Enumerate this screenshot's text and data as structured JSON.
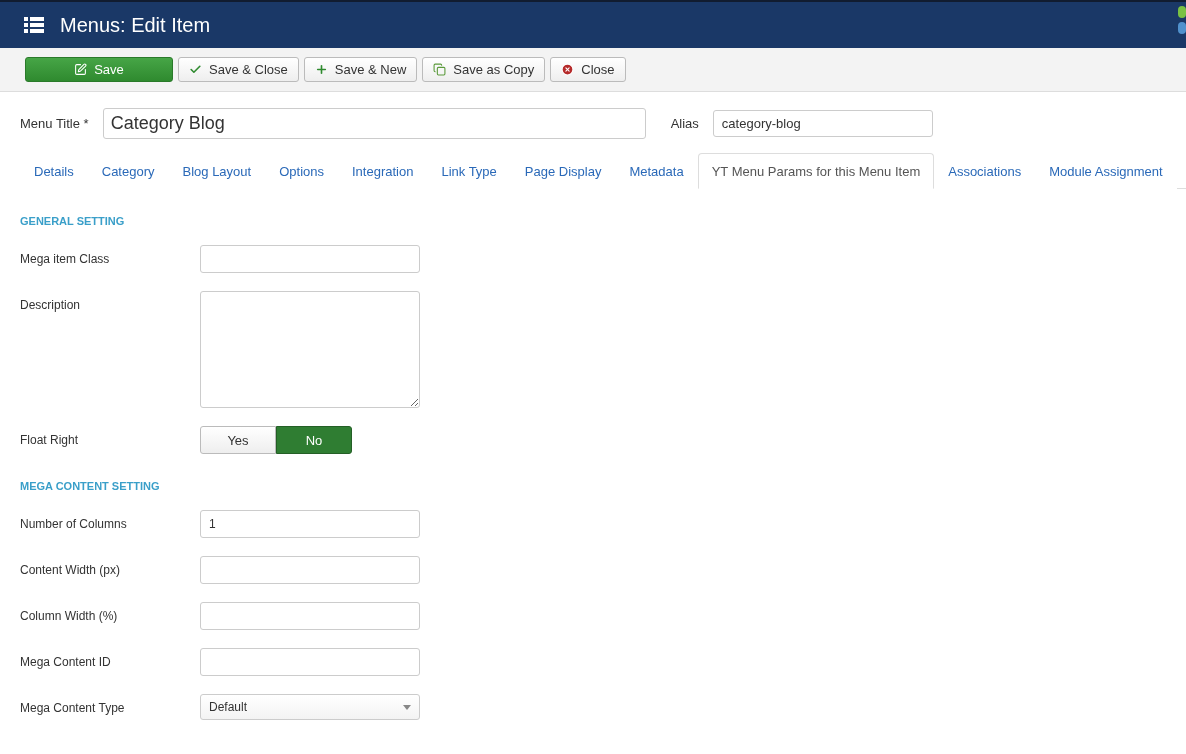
{
  "header": {
    "title": "Menus: Edit Item"
  },
  "toolbar": [
    {
      "label": "Save",
      "kind": "save",
      "primary": true
    },
    {
      "label": "Save & Close",
      "kind": "check",
      "primary": false
    },
    {
      "label": "Save & New",
      "kind": "plus",
      "primary": false
    },
    {
      "label": "Save as Copy",
      "kind": "copy",
      "primary": false
    },
    {
      "label": "Close",
      "kind": "close",
      "primary": false
    }
  ],
  "title_row": {
    "label": "Menu Title *",
    "value": "Category Blog",
    "alias_label": "Alias",
    "alias_value": "category-blog"
  },
  "tabs": [
    {
      "label": "Details",
      "selected": false
    },
    {
      "label": "Category",
      "selected": false
    },
    {
      "label": "Blog Layout",
      "selected": false
    },
    {
      "label": "Options",
      "selected": false
    },
    {
      "label": "Integration",
      "selected": false
    },
    {
      "label": "Link Type",
      "selected": false
    },
    {
      "label": "Page Display",
      "selected": false
    },
    {
      "label": "Metadata",
      "selected": false
    },
    {
      "label": "YT Menu Params for this Menu Item",
      "selected": true
    },
    {
      "label": "Associations",
      "selected": false
    },
    {
      "label": "Module Assignment",
      "selected": false
    }
  ],
  "sections": [
    {
      "heading": "GENERAL SETTING",
      "fields": [
        {
          "label": "Mega item Class",
          "kind": "text"
        },
        {
          "label": "Description",
          "kind": "textarea"
        },
        {
          "label": "Float Right",
          "kind": "toggle",
          "options": [
            {
              "label": "Yes",
              "selected": false
            },
            {
              "label": "No",
              "selected": true
            }
          ]
        }
      ]
    },
    {
      "heading": "MEGA CONTENT SETTING",
      "fields": [
        {
          "label": "Number of Columns",
          "kind": "text",
          "value": "1"
        },
        {
          "label": "Content Width (px)",
          "kind": "text"
        },
        {
          "label": "Column Width (%)",
          "kind": "text"
        },
        {
          "label": "Mega Content ID",
          "kind": "text"
        },
        {
          "label": "Mega Content Type",
          "kind": "select",
          "value": "Default"
        }
      ]
    }
  ]
}
